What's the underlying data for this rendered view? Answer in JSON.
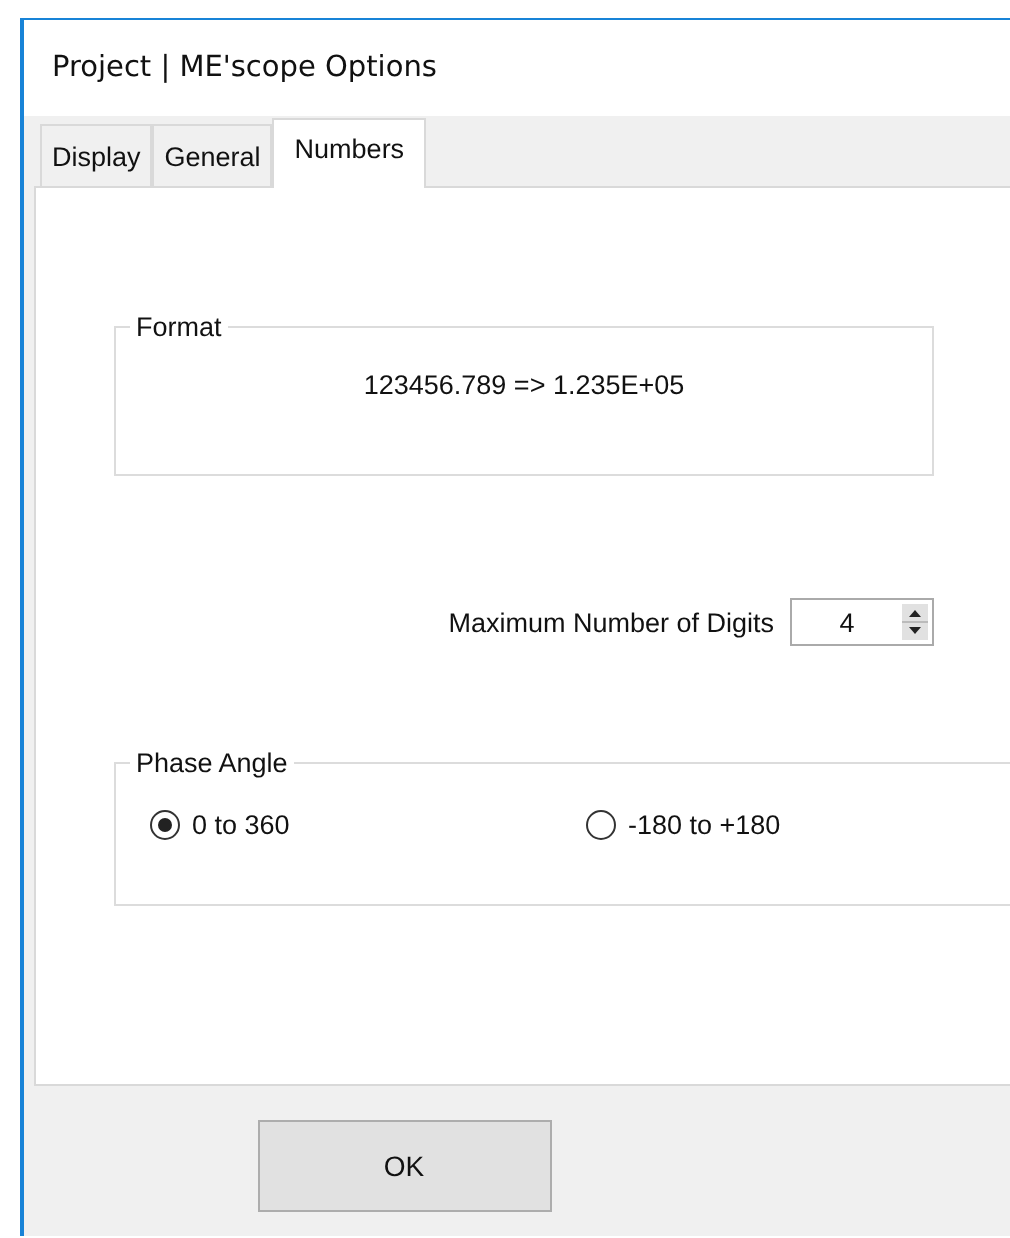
{
  "window": {
    "title": "Project | ME'scope Options"
  },
  "tabs": [
    {
      "label": "Display",
      "selected": false
    },
    {
      "label": "General",
      "selected": false
    },
    {
      "label": "Numbers",
      "selected": true
    }
  ],
  "format": {
    "title": "Format",
    "example": "123456.789 => 1.235E+05"
  },
  "max_digits": {
    "label": "Maximum Number of Digits",
    "value": "4"
  },
  "phase_angle": {
    "title": "Phase Angle",
    "options": [
      {
        "label": "0 to 360",
        "selected": true
      },
      {
        "label": "-180 to +180",
        "selected": false
      }
    ]
  },
  "buttons": [
    "OK"
  ]
}
